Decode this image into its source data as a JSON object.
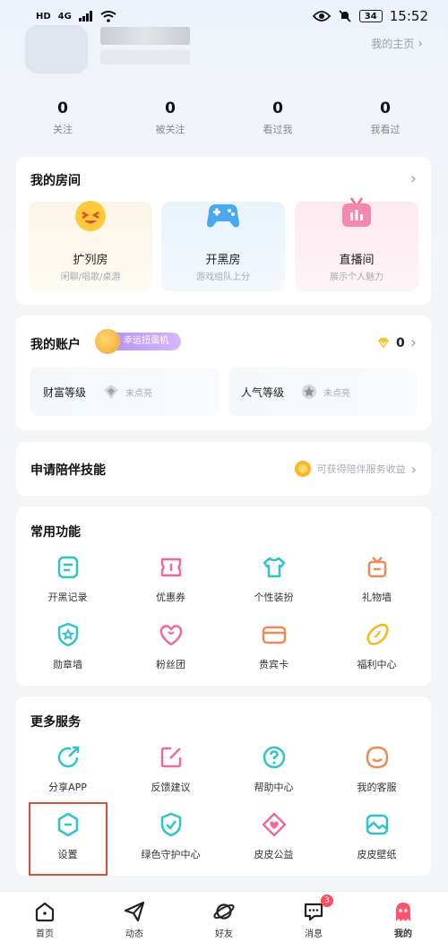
{
  "status_bar": {
    "left_badges": [
      "HD",
      "4G"
    ],
    "time": "15:52",
    "battery": "34"
  },
  "profile": {
    "home_link": "我的主页"
  },
  "stats": [
    {
      "value": "0",
      "label": "关注"
    },
    {
      "value": "0",
      "label": "被关注"
    },
    {
      "value": "0",
      "label": "看过我"
    },
    {
      "value": "0",
      "label": "我看过"
    }
  ],
  "my_room": {
    "title": "我的房间",
    "rooms": [
      {
        "name": "扩列房",
        "desc": "闲聊/唱歌/桌游",
        "icon": "smile-face-icon"
      },
      {
        "name": "开黑房",
        "desc": "游戏组队上分",
        "icon": "gamepad-icon"
      },
      {
        "name": "直播间",
        "desc": "展示个人魅力",
        "icon": "tv-icon"
      }
    ]
  },
  "my_account": {
    "title": "我的账户",
    "badge": "幸运扭蛋机",
    "coin_count": "0",
    "levels": [
      {
        "label": "财富等级",
        "value": "未点亮"
      },
      {
        "label": "人气等级",
        "value": "未点亮"
      }
    ]
  },
  "companion": {
    "title": "申请陪伴技能",
    "hint": "可获得陪伴服务收益"
  },
  "common_functions": {
    "title": "常用功能",
    "items": [
      {
        "label": "开黑记录",
        "icon": "record-icon"
      },
      {
        "label": "优惠券",
        "icon": "coupon-icon"
      },
      {
        "label": "个性装扮",
        "icon": "tshirt-icon"
      },
      {
        "label": "礼物墙",
        "icon": "gift-wall-icon"
      },
      {
        "label": "勋章墙",
        "icon": "medal-icon"
      },
      {
        "label": "粉丝团",
        "icon": "heart-icon"
      },
      {
        "label": "贵宾卡",
        "icon": "card-icon"
      },
      {
        "label": "福利中心",
        "icon": "bean-icon"
      }
    ]
  },
  "more_services": {
    "title": "更多服务",
    "items": [
      {
        "label": "分享APP",
        "icon": "share-icon"
      },
      {
        "label": "反馈建议",
        "icon": "edit-icon"
      },
      {
        "label": "帮助中心",
        "icon": "help-icon"
      },
      {
        "label": "我的客服",
        "icon": "service-icon"
      },
      {
        "label": "设置",
        "icon": "settings-icon"
      },
      {
        "label": "绿色守护中心",
        "icon": "shield-icon"
      },
      {
        "label": "皮皮公益",
        "icon": "charity-icon"
      },
      {
        "label": "皮皮壁纸",
        "icon": "wallpaper-icon"
      }
    ]
  },
  "bottom_nav": [
    {
      "label": "首页",
      "icon": "home-icon"
    },
    {
      "label": "动态",
      "icon": "send-icon"
    },
    {
      "label": "好友",
      "icon": "planet-icon"
    },
    {
      "label": "消息",
      "icon": "message-icon",
      "badge": "3"
    },
    {
      "label": "我的",
      "icon": "ghost-icon"
    }
  ],
  "colors": {
    "accent_teal": "#2fc4c6",
    "accent_pink": "#f06a95",
    "accent_orange": "#f08a55",
    "gacha_purple": "#b38cf3"
  }
}
